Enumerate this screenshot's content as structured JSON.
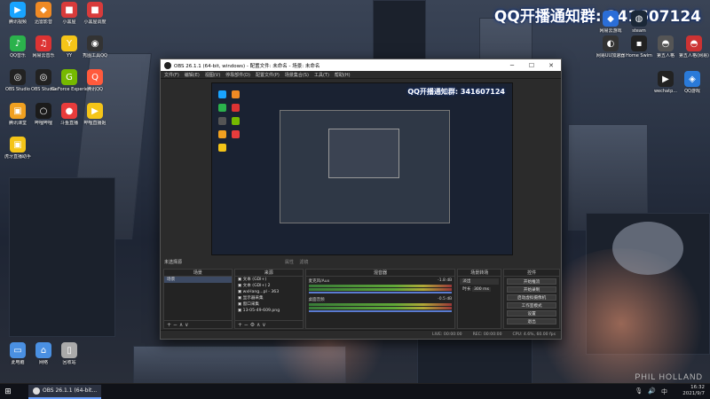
{
  "watermark": "QQ开播通知群: 341607124",
  "credit": "PHIL HOLLAND",
  "desktop_icons_left": [
    {
      "label": "腾讯视频",
      "color": "#19a4ff",
      "glyph": "▶"
    },
    {
      "label": "迅雷影音",
      "color": "#f08a24",
      "glyph": "◆"
    },
    {
      "label": "小黑屋",
      "color": "#d83b3b",
      "glyph": "■"
    },
    {
      "label": "小黑屋调度",
      "color": "#d83b3b",
      "glyph": "■"
    },
    {
      "label": "QQ音乐",
      "color": "#2bb24c",
      "glyph": "♪"
    },
    {
      "label": "网易云音乐",
      "color": "#d33",
      "glyph": "♫"
    },
    {
      "label": "YY",
      "color": "#f5c518",
      "glyph": "Y"
    },
    {
      "label": "秀图工具QQ",
      "color": "#333",
      "glyph": "◉"
    },
    {
      "label": "OBS Studio",
      "color": "#222",
      "glyph": "◎"
    },
    {
      "label": "OBS Studio",
      "color": "#222",
      "glyph": "◎"
    },
    {
      "label": "GeForce Experience",
      "color": "#76b900",
      "glyph": "G"
    },
    {
      "label": "腾讯QQ",
      "color": "#ff5a3c",
      "glyph": "Q"
    },
    {
      "label": "腾讯课堂",
      "color": "#f0a020",
      "glyph": "▣"
    },
    {
      "label": "哔哩哔哩",
      "color": "#1b1b1b",
      "glyph": "○"
    },
    {
      "label": "斗鱼直播",
      "color": "#e83c3c",
      "glyph": "●"
    },
    {
      "label": "哔哩直播姬",
      "color": "#f5c518",
      "glyph": "▶"
    },
    {
      "label": "虎牙直播助手",
      "color": "#f5c518",
      "glyph": "▣"
    }
  ],
  "desktop_icons_bottom": [
    {
      "label": "此电脑",
      "color": "#4a90e2",
      "glyph": "▭"
    },
    {
      "label": "网络",
      "color": "#4a90e2",
      "glyph": "⌂"
    },
    {
      "label": "回收站",
      "color": "#aaa",
      "glyph": "▯"
    }
  ],
  "desktop_icons_right": [
    {
      "label": "网易UU加速器",
      "color": "#333",
      "glyph": "◐"
    },
    {
      "label": "Home Swim",
      "color": "#222",
      "glyph": "▪"
    },
    {
      "label": "第五人格",
      "color": "#555",
      "glyph": "◓"
    },
    {
      "label": "第五人格(网易)",
      "color": "#c33",
      "glyph": "◓"
    },
    {
      "label": "wechatp...",
      "color": "#222",
      "glyph": "▶"
    },
    {
      "label": "QQ游戏",
      "color": "#2a7ad9",
      "glyph": "◈"
    },
    {
      "label": "steam",
      "color": "#1b2838",
      "glyph": "◍"
    },
    {
      "label": "网易云游戏",
      "color": "#2b6ed8",
      "glyph": "◆"
    }
  ],
  "obs": {
    "title": "OBS 26.1.1 (64-bit, windows) - 配置文件: 未命名 - 场景: 未命名",
    "menu": [
      "文件(F)",
      "编辑(E)",
      "视图(V)",
      "停靠部件(D)",
      "配置文件(P)",
      "场景集合(S)",
      "工具(T)",
      "帮助(H)"
    ],
    "preview_mark": "QQ开播通知群: 341607124",
    "scene_bar": "未选择源",
    "src_props": "属性",
    "src_filters": "滤镜",
    "docks": {
      "scenes": {
        "title": "场景",
        "items": [
          "场景"
        ]
      },
      "sources": {
        "title": "来源",
        "items": [
          "文本 (GDI+)",
          "文本 (GDI+) 2",
          "wxHang...pl - 363",
          "显示器采集",
          "窗口采集",
          "13-05-49-609.png"
        ]
      },
      "mixer": {
        "title": "混音器",
        "channels": [
          {
            "name": "麦克风/Aux",
            "db": "-1.8 dB"
          },
          {
            "name": "桌面音频",
            "db": "-0.5 dB"
          }
        ]
      },
      "transitions": {
        "title": "场景转场",
        "type": "淡出",
        "duration_label": "时长",
        "duration": "300 ms"
      },
      "controls": {
        "title": "控件",
        "buttons": [
          "开始推流",
          "开始录制",
          "启动虚拟摄像机",
          "工作室模式",
          "设置",
          "退出"
        ]
      }
    },
    "status": {
      "live": "LIVE: 00:00:00",
      "rec": "REC: 00:00:00",
      "cpu": "CPU: 4.6%, 60.00 fps"
    }
  },
  "taskbar": {
    "start_icon": "windows-icon",
    "task_label": "OBS 26.1.1 (64-bit...",
    "time": "16:32",
    "date": "2021/9/7"
  }
}
